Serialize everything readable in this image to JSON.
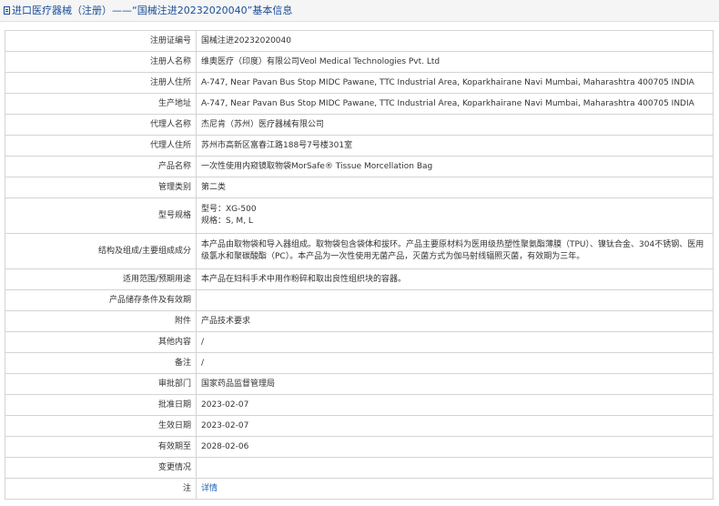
{
  "header": {
    "title": "进口医疗器械（注册）——“国械注进20232020040”基本信息"
  },
  "rows": {
    "reg_no": {
      "label": "注册证编号",
      "value": "国械注进20232020040"
    },
    "registrant": {
      "label": "注册人名称",
      "value": "维奥医疗（印度）有限公司Veol Medical Technologies Pvt. Ltd"
    },
    "registrant_addr": {
      "label": "注册人住所",
      "value": "A-747, Near Pavan Bus Stop MIDC Pawane, TTC Industrial Area, Koparkhairane Navi Mumbai, Maharashtra 400705 INDIA"
    },
    "production_addr": {
      "label": "生产地址",
      "value": "A-747, Near Pavan Bus Stop MIDC Pawane, TTC Industrial Area, Koparkhairane Navi Mumbai, Maharashtra 400705 INDIA"
    },
    "agent": {
      "label": "代理人名称",
      "value": "杰尼肯（苏州）医疗器械有限公司"
    },
    "agent_addr": {
      "label": "代理人住所",
      "value": "苏州市高新区富春江路188号7号楼301室"
    },
    "product_name": {
      "label": "产品名称",
      "value": "一次性使用内窥镜取物袋MorSafe® Tissue Morcellation Bag"
    },
    "category": {
      "label": "管理类别",
      "value": "第二类"
    },
    "model": {
      "label": "型号规格",
      "line1": "型号：XG-500",
      "line2": "规格：S, M, L"
    },
    "composition": {
      "label": "结构及组成/主要组成成分",
      "value": "本产品由取物袋和导入器组成。取物袋包含袋体和拔环。产品主要原材料为医用级热塑性聚氨酯薄膜（TPU）、镍钛合金、304不锈钢、医用级氯水和聚碳酸酯（PC）。本产品为一次性使用无菌产品，灭菌方式为伽马射线辐照灭菌，有效期为三年。"
    },
    "scope": {
      "label": "适用范围/预期用途",
      "value": "本产品在妇科手术中用作粉碎和取出良性组织块的容器。"
    },
    "storage": {
      "label": "产品储存条件及有效期",
      "value": ""
    },
    "attachment": {
      "label": "附件",
      "value": "产品技术要求"
    },
    "other": {
      "label": "其他内容",
      "value": "/"
    },
    "remark": {
      "label": "备注",
      "value": "/"
    },
    "approval_dept": {
      "label": "审批部门",
      "value": "国家药品监督管理局"
    },
    "approval_date": {
      "label": "批准日期",
      "value": "2023-02-07"
    },
    "effective_date": {
      "label": "生效日期",
      "value": "2023-02-07"
    },
    "expiry_date": {
      "label": "有效期至",
      "value": "2028-02-06"
    },
    "change": {
      "label": "变更情况",
      "value": ""
    },
    "note": {
      "label": "注",
      "link": "详情"
    }
  }
}
